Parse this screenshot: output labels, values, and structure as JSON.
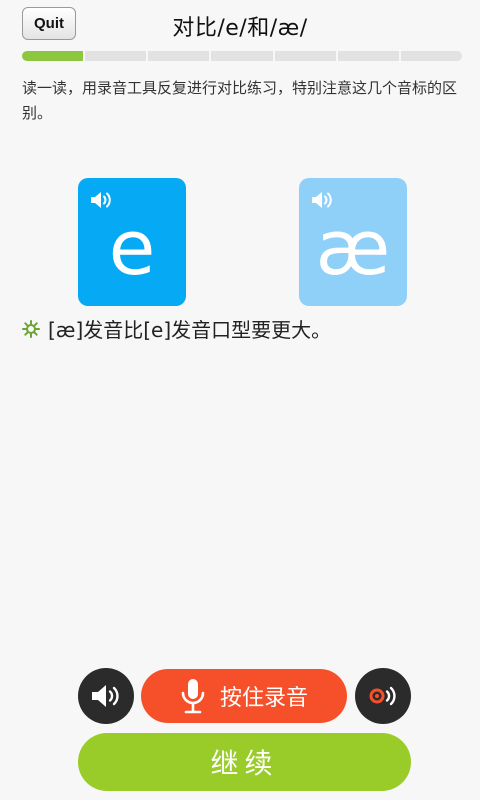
{
  "header": {
    "quit_label": "Quit",
    "title": "对比/e/和/æ/"
  },
  "progress": {
    "total_steps": 7,
    "completed_steps": 1,
    "accent_color": "#8dc63f"
  },
  "instruction": "读一读，用录音工具反复进行对比练习，特别注意这几个音标的区别。",
  "cards": [
    {
      "symbol": "e",
      "color": "#05a9f4",
      "icon": "speaker-icon"
    },
    {
      "symbol": "æ",
      "color": "#8fd0f8",
      "icon": "speaker-icon"
    }
  ],
  "tip": {
    "icon": "gear-icon",
    "text": "[æ]发音比[e]发音口型要更大。",
    "icon_color": "#6aa434"
  },
  "controls": {
    "play_icon": "speaker-icon",
    "record_label": "按住录音",
    "record_icon": "microphone-icon",
    "record_color": "#f6502a",
    "playback_icon": "playback-icon",
    "continue_label": "继续",
    "continue_color": "#99cc29"
  }
}
